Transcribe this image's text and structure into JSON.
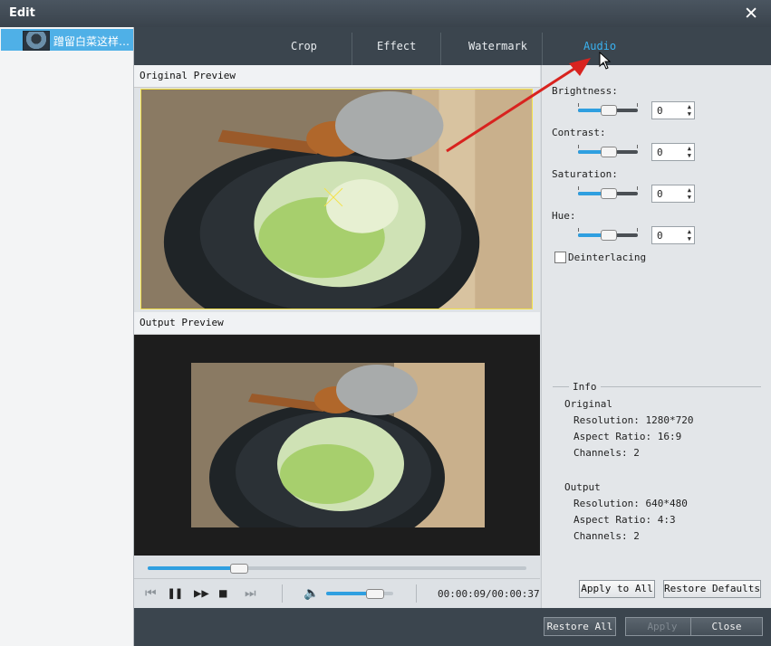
{
  "window": {
    "title": "Edit"
  },
  "sidebar": {
    "items": [
      {
        "label": "蹭留白菜这样…",
        "selected": true
      }
    ]
  },
  "tabs": [
    {
      "label": "Crop",
      "active": false
    },
    {
      "label": "Effect",
      "active": false
    },
    {
      "label": "Watermark",
      "active": false
    },
    {
      "label": "Audio",
      "active": true
    }
  ],
  "preview": {
    "original_label": "Original Preview",
    "output_label": "Output Preview"
  },
  "playback": {
    "time": "00:00:09/00:00:37",
    "progress": 0.24,
    "volume": 0.72
  },
  "adjustments": [
    {
      "label": "Brightness:",
      "value": "0",
      "level": 0.5
    },
    {
      "label": "Contrast:",
      "value": "0",
      "level": 0.5
    },
    {
      "label": "Saturation:",
      "value": "0",
      "level": 0.5
    },
    {
      "label": "Hue:",
      "value": "0",
      "level": 0.5
    }
  ],
  "deinterlacing": {
    "label": "Deinterlacing",
    "checked": false
  },
  "info": {
    "heading": "Info",
    "original": {
      "heading": "Original",
      "resolution": "Resolution: 1280*720",
      "aspect": "Aspect Ratio: 16:9",
      "channels": "Channels: 2"
    },
    "output": {
      "heading": "Output",
      "resolution": "Resolution: 640*480",
      "aspect": "Aspect Ratio: 4:3",
      "channels": "Channels: 2"
    }
  },
  "buttons": {
    "apply_to_all": "Apply to All",
    "restore_defaults": "Restore Defaults",
    "restore_all": "Restore All",
    "apply": "Apply",
    "close": "Close"
  },
  "icons": {
    "close": "close-icon",
    "play": "play-icon",
    "pause": "pause-icon",
    "stop": "stop-icon",
    "prev": "prev-frame-icon",
    "next": "next-frame-icon",
    "volume": "volume-icon",
    "cursor": "mouse-cursor-icon",
    "arrow": "annotation-arrow"
  },
  "colors": {
    "accent": "#3ab2f0",
    "titlebar": "#3b454e",
    "highlight": "#4fb0e7"
  }
}
